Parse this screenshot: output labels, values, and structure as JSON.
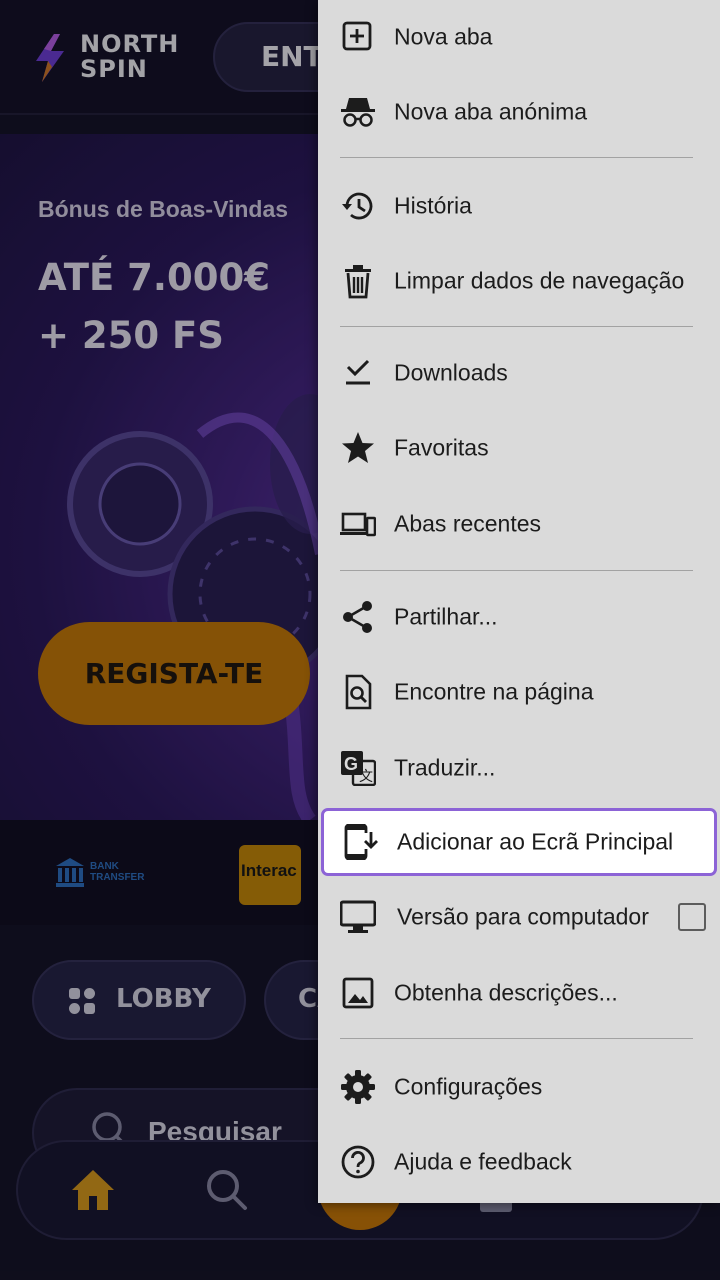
{
  "site": {
    "logo_text": "NORTH\nSPIN",
    "enter_label": "ENTRAR",
    "hero_subtitle": "Bónus de Boas-Vindas",
    "hero_title": "ATÉ 7.000€\n+ 250 FS",
    "register_label": "REGISTA-TE",
    "payments": {
      "bank_label": "BANK\nTRANSFER",
      "interac_label": "Interac"
    },
    "lobby_label": "LOBBY",
    "category_label": "CASINO",
    "search_placeholder": "Pesquisar",
    "colors": {
      "accent": "#c4790a",
      "background": "#16142a",
      "hero": "#452682"
    }
  },
  "menu": {
    "items": [
      {
        "label": "Nova aba",
        "icon": "new-tab-icon"
      },
      {
        "label": "Nova aba anónima",
        "icon": "incognito-icon"
      },
      {
        "label": "História",
        "icon": "history-icon"
      },
      {
        "label": "Limpar dados de navegação",
        "icon": "trash-icon"
      },
      {
        "label": "Downloads",
        "icon": "downloads-icon"
      },
      {
        "label": "Favoritas",
        "icon": "star-icon"
      },
      {
        "label": "Abas recentes",
        "icon": "recent-tabs-icon"
      },
      {
        "label": "Partilhar...",
        "icon": "share-icon"
      },
      {
        "label": "Encontre na página",
        "icon": "find-in-page-icon"
      },
      {
        "label": "Traduzir...",
        "icon": "translate-icon"
      },
      {
        "label": "Adicionar ao Ecrã Principal",
        "icon": "add-to-home-screen-icon",
        "highlighted": true
      },
      {
        "label": "Versão para computador",
        "icon": "desktop-icon",
        "checked": false
      },
      {
        "label": "Obtenha descrições...",
        "icon": "image-descriptions-icon"
      },
      {
        "label": "Configurações",
        "icon": "settings-icon"
      },
      {
        "label": "Ajuda e feedback",
        "icon": "help-icon"
      }
    ],
    "colors": {
      "background": "#dadada",
      "highlight_border": "#8c63d6"
    }
  }
}
